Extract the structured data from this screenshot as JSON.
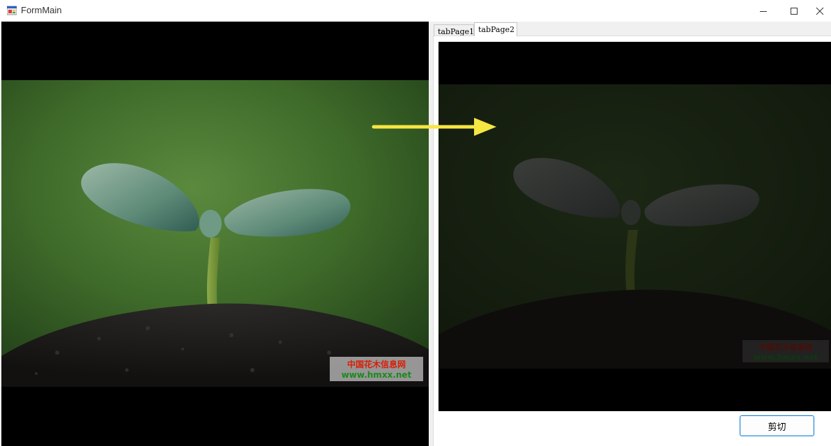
{
  "window": {
    "title": "FormMain",
    "controls": {
      "minimize_icon": "minimize-icon",
      "maximize_icon": "maximize-icon",
      "close_icon": "close-icon"
    }
  },
  "tabs": [
    {
      "label": "tabPage1",
      "selected": false
    },
    {
      "label": "tabPage2",
      "selected": true
    }
  ],
  "buttons": {
    "cut_label": "剪切"
  },
  "watermark": {
    "line1": "中国花木信息网",
    "line2": "www.hmxx.net"
  },
  "colors": {
    "accent": "#0078d4",
    "arrow": "#f5e642",
    "watermark_red": "#d81e06",
    "watermark_green": "#1a8a1a"
  }
}
